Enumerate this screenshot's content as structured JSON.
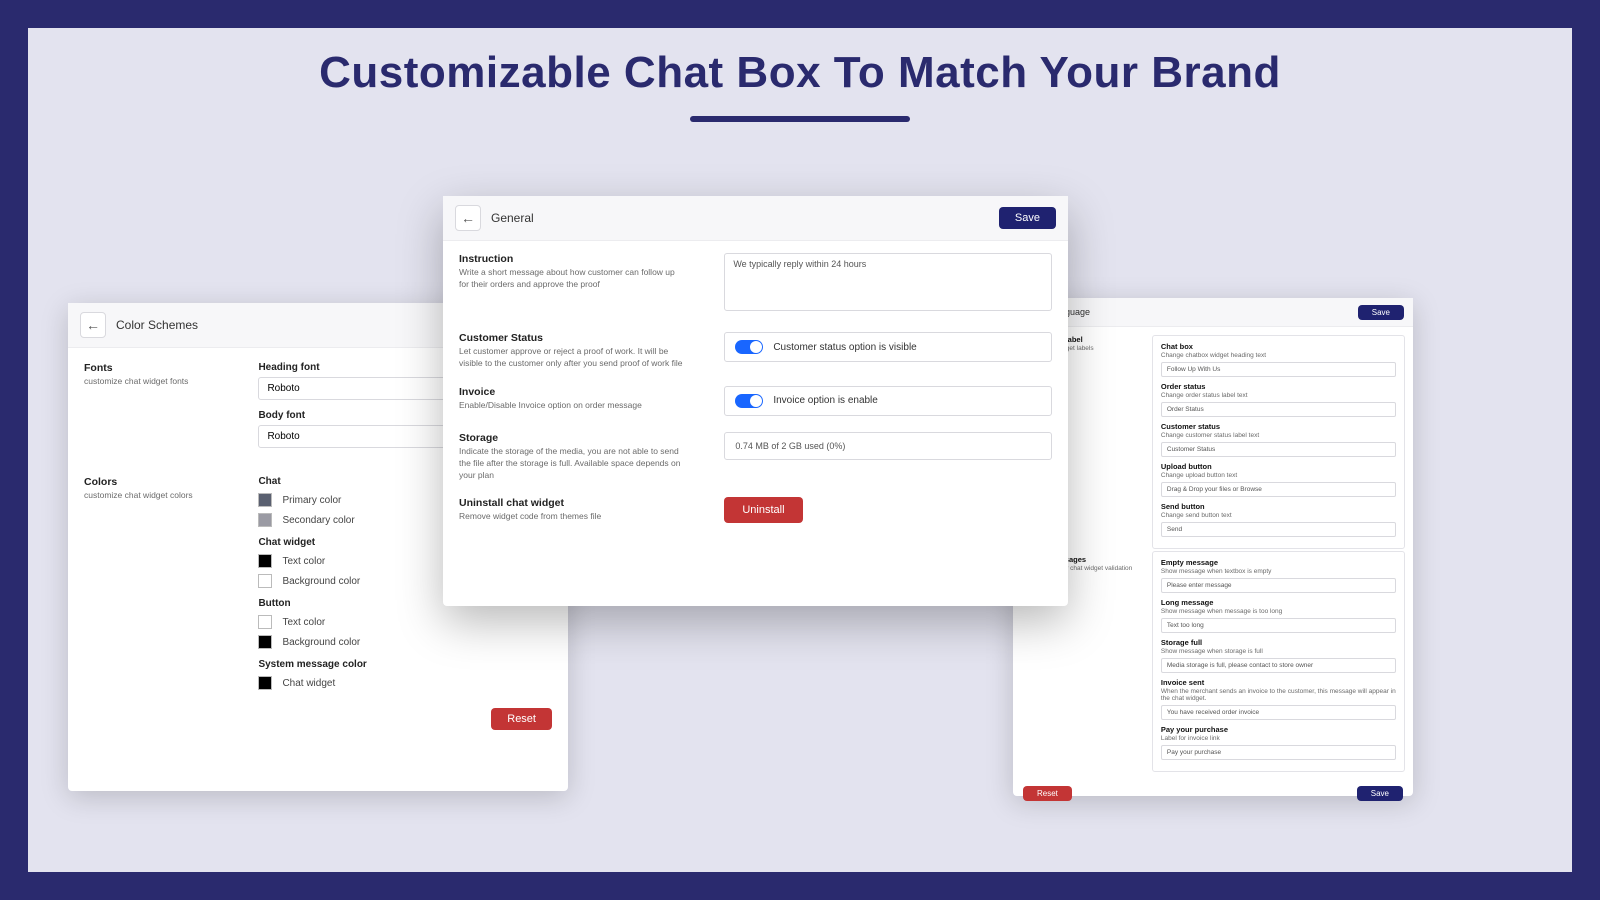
{
  "hero": {
    "title": "Customizable Chat Box To Match Your Brand"
  },
  "general": {
    "title": "General",
    "save": "Save",
    "instruction": {
      "h": "Instruction",
      "sub": "Write a short message about how customer can follow up for their orders and approve the proof",
      "value": "We typically reply within 24 hours"
    },
    "customer_status": {
      "h": "Customer Status",
      "sub": "Let customer approve or reject a proof of work. It will be visible to the customer only after you send proof of work file",
      "toggle_label": "Customer status option is visible"
    },
    "invoice": {
      "h": "Invoice",
      "sub": "Enable/Disable Invoice option on order message",
      "toggle_label": "Invoice option is enable"
    },
    "storage": {
      "h": "Storage",
      "sub": "Indicate the storage of the media, you are not able to send the file after the storage is full. Available space depends on your plan",
      "value": "0.74 MB of 2 GB used (0%)"
    },
    "uninstall": {
      "h": "Uninstall chat widget",
      "sub": "Remove widget code from themes file",
      "btn": "Uninstall"
    }
  },
  "colors": {
    "title": "Color Schemes",
    "fonts": {
      "h": "Fonts",
      "sub": "customize chat widget fonts",
      "heading_lbl": "Heading font",
      "body_lbl": "Body font",
      "heading_val": "Roboto",
      "body_val": "Roboto",
      "meta": "Roboto | sans-serif"
    },
    "colors": {
      "h": "Colors",
      "sub": "customize chat widget colors",
      "chat_h": "Chat",
      "chat": [
        [
          "#5a6070",
          "Primary color"
        ],
        [
          "#9a9aa3",
          "Secondary color"
        ]
      ],
      "widget_h": "Chat widget",
      "widget": [
        [
          "#000000",
          "Text color"
        ],
        [
          "#ffffff",
          "Background color"
        ]
      ],
      "button_h": "Button",
      "button": [
        [
          "#ffffff",
          "Text color"
        ],
        [
          "#000000",
          "Background color"
        ]
      ],
      "sys_h": "System message color",
      "sys": [
        [
          "#000000",
          "Chat widget"
        ]
      ]
    },
    "reset": "Reset"
  },
  "language": {
    "title": "Language",
    "save": "Save",
    "reset": "Reset",
    "left_label_h": "Chat widget label",
    "left_label_sub": "Modify chat widget labels",
    "sys_left_h": "System messages",
    "sys_left_sub": "Change / modify chat widget validation error messages",
    "fields": {
      "chat_box": {
        "h": "Chat box",
        "sub": "Change chatbox widget heading text",
        "v": "Follow Up With Us"
      },
      "order_status": {
        "h": "Order status",
        "sub": "Change order status label text",
        "v": "Order Status"
      },
      "customer_status": {
        "h": "Customer status",
        "sub": "Change customer status label text",
        "v": "Customer Status"
      },
      "upload": {
        "h": "Upload button",
        "sub": "Change upload button text",
        "v": "Drag & Drop your files or Browse"
      },
      "send": {
        "h": "Send button",
        "sub": "Change send button text",
        "v": "Send"
      },
      "empty": {
        "h": "Empty message",
        "sub": "Show message when textbox is empty",
        "v": "Please enter message"
      },
      "long": {
        "h": "Long message",
        "sub": "Show message when message is too long",
        "v": "Text too long"
      },
      "storage_full": {
        "h": "Storage full",
        "sub": "Show message when storage is full",
        "v": "Media storage is full, please contact to store owner"
      },
      "invoice_sent": {
        "h": "Invoice sent",
        "sub": "When the merchant sends an invoice to the customer, this message will appear in the chat widget.",
        "v": "You have received order invoice"
      },
      "pay": {
        "h": "Pay your purchase",
        "sub": "Label for invoice link",
        "v": "Pay your purchase"
      }
    }
  }
}
